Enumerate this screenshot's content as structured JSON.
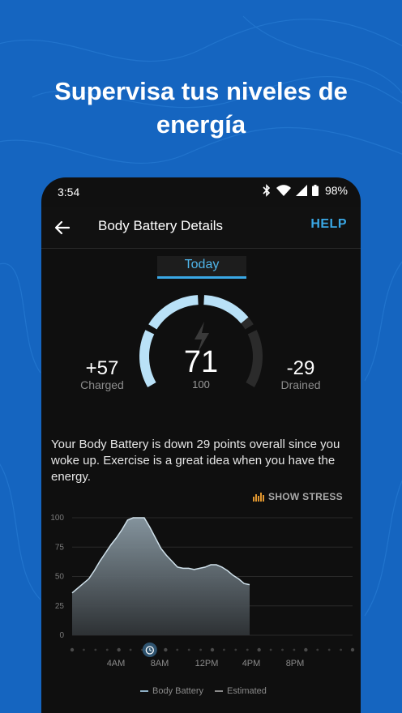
{
  "headline": {
    "line1": "Supervisa tus niveles de",
    "line2": "energía"
  },
  "status_bar": {
    "time": "3:54",
    "battery": "98%"
  },
  "app_bar": {
    "title": "Body Battery Details",
    "help_label": "HELP"
  },
  "tab": {
    "label": "Today"
  },
  "gauge": {
    "value": "71",
    "max": "100",
    "charged_value": "+57",
    "charged_label": "Charged",
    "drained_value": "-29",
    "drained_label": "Drained",
    "accent_color": "#b9e1f7",
    "empty_color": "#2b2b2b"
  },
  "description": "Your Body Battery is down 29 points overall since you woke up. Exercise is a great idea when you have the energy.",
  "show_stress_label": "SHOW STRESS",
  "stress_color": "#e0962f",
  "chart_data": {
    "type": "area",
    "y_ticks": [
      "100",
      "75",
      "50",
      "25",
      "0"
    ],
    "ylim": [
      0,
      100
    ],
    "x_tick_labels": [
      "4AM",
      "8AM",
      "12PM",
      "4PM",
      "8PM"
    ],
    "x_hours": [
      0,
      0.5,
      1,
      1.5,
      2,
      2.5,
      3,
      3.5,
      4,
      4.5,
      5,
      5.5,
      6,
      6.5,
      7,
      7.5,
      8,
      8.5,
      9,
      9.5,
      10,
      10.5,
      11,
      11.5,
      12,
      12.5,
      13,
      13.5,
      14,
      14.5,
      15,
      15.5,
      16
    ],
    "values": [
      36,
      40,
      44,
      48,
      55,
      63,
      70,
      77,
      83,
      90,
      98,
      100,
      100,
      100,
      92,
      83,
      74,
      68,
      63,
      58,
      57,
      57,
      56,
      57,
      58,
      60,
      60,
      58,
      55,
      51,
      48,
      44,
      43
    ],
    "series": [
      {
        "name": "Body Battery",
        "color": "#8fb0c6"
      },
      {
        "name": "Estimated",
        "color": "#8a8a8a"
      }
    ],
    "wake_marker_hour": 7
  }
}
